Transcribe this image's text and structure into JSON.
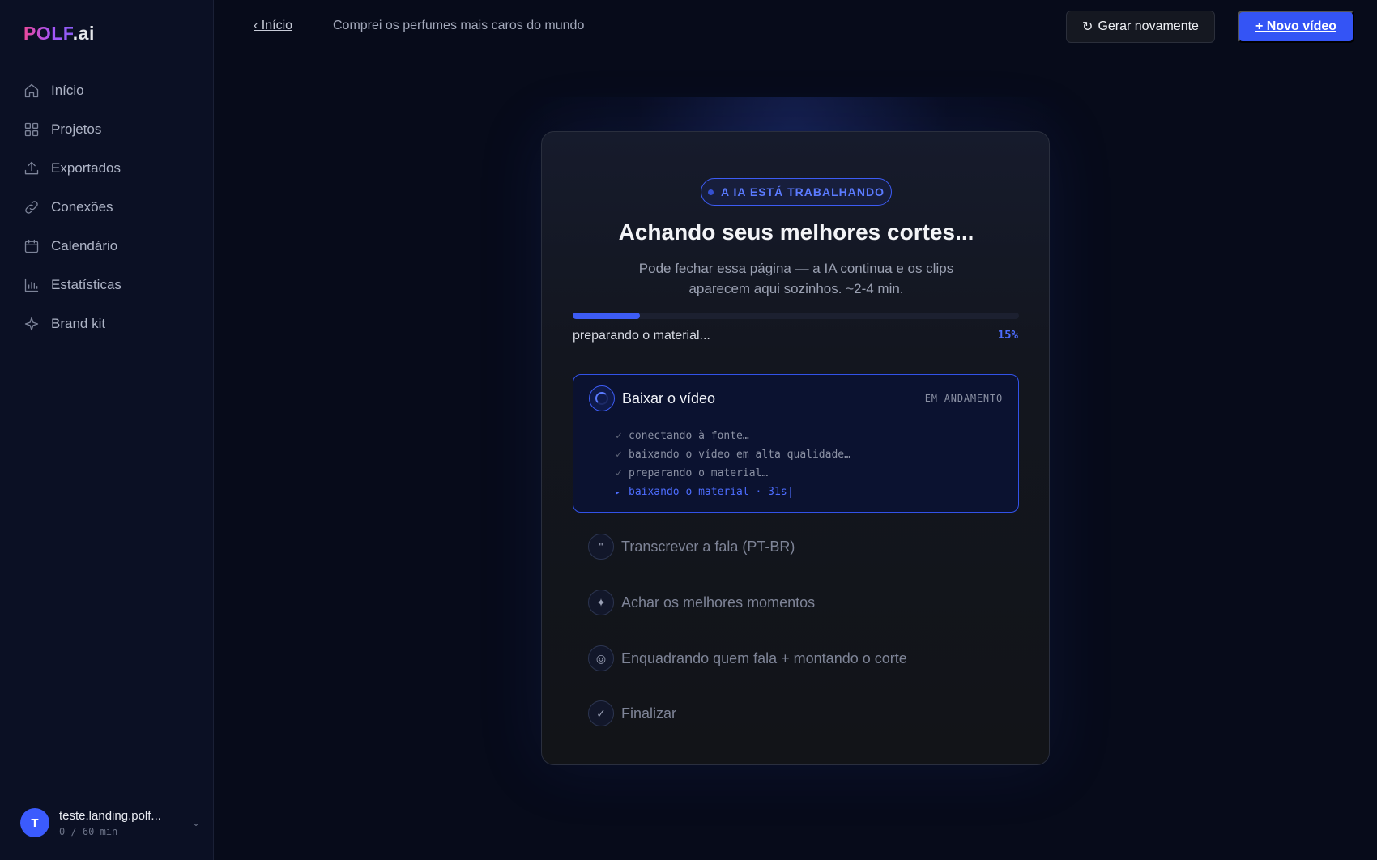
{
  "app": {
    "logo_brand": "POLF",
    "logo_tld": ".ai"
  },
  "sidebar": {
    "items": [
      {
        "label": "Início",
        "icon": "home-icon"
      },
      {
        "label": "Projetos",
        "icon": "grid-icon"
      },
      {
        "label": "Exportados",
        "icon": "upload-icon"
      },
      {
        "label": "Conexões",
        "icon": "link-icon"
      },
      {
        "label": "Calendário",
        "icon": "calendar-icon"
      },
      {
        "label": "Estatísticas",
        "icon": "bar-chart-icon"
      },
      {
        "label": "Brand kit",
        "icon": "sparkle-icon"
      }
    ],
    "user": {
      "initial": "T",
      "name": "teste.landing.polf...",
      "usage": "0 / 60 min"
    }
  },
  "topbar": {
    "back_label": "‹ Início",
    "page_title": "Comprei os perfumes mais caros do mundo",
    "regen_label": "Gerar novamente",
    "new_label": "+ Novo vídeo"
  },
  "card": {
    "badge": "A IA ESTÁ TRABALHANDO",
    "title": "Achando seus melhores cortes...",
    "subtitle": "Pode fechar essa página — a IA continua e os clips aparecem aqui sozinhos. ~2-4 min.",
    "progress": {
      "label": "preparando o material...",
      "percent": 15,
      "percent_label": "15%"
    },
    "active_step": {
      "name": "Baixar o vídeo",
      "status": "EM ANDAMENTO",
      "substeps": [
        {
          "mark": "✓",
          "text": "conectando à fonte…"
        },
        {
          "mark": "✓",
          "text": "baixando o vídeo em alta qualidade…"
        },
        {
          "mark": "✓",
          "text": "preparando o material…"
        },
        {
          "mark": "▸",
          "text": "baixando o material · 31s"
        }
      ]
    },
    "steps": [
      {
        "name": "Transcrever a fala (PT-BR)",
        "glyph": "\"",
        "icon": "quote-icon"
      },
      {
        "name": "Achar os melhores momentos",
        "glyph": "✦",
        "icon": "sparkle-icon"
      },
      {
        "name": "Enquadrando quem fala + montando o corte",
        "glyph": "◎",
        "icon": "target-icon"
      },
      {
        "name": "Finalizar",
        "glyph": "✓",
        "icon": "check-icon"
      }
    ]
  },
  "colors": {
    "accent": "#3454f5",
    "background": "#070b1a",
    "sidebar": "#0b1024"
  }
}
